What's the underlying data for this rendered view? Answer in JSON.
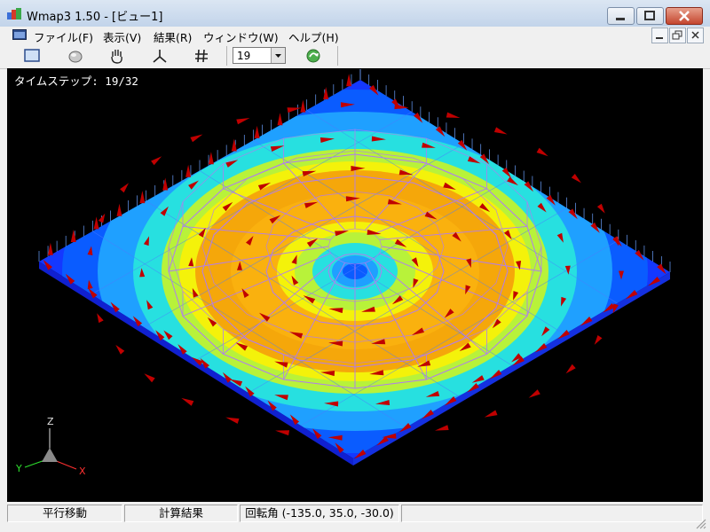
{
  "window": {
    "title": "Wmap3 1.50 - [ビュー1]"
  },
  "menu": {
    "items": [
      {
        "label": "ファイル(F)"
      },
      {
        "label": "表示(V)"
      },
      {
        "label": "結果(R)"
      },
      {
        "label": "ウィンドウ(W)"
      },
      {
        "label": "ヘルプ(H)"
      }
    ]
  },
  "toolbar": {
    "icons": [
      "fit-view-icon",
      "rotate-view-icon",
      "pan-hand-icon",
      "axes-icon",
      "grid-hash-icon",
      "step-forward-icon"
    ],
    "timestep_select": {
      "value": "19"
    }
  },
  "viewport": {
    "timestep_label": "タイムステップ: 19/32",
    "axes": {
      "z": "Z",
      "y": "Y",
      "x": "X"
    },
    "colors": {
      "background": "#000000",
      "mesh": "#b07cf0",
      "arrow": "#c00000"
    }
  },
  "statusbar": {
    "mode": "平行移動",
    "panel": "計算結果",
    "rotation": "回転角 (-135.0, 35.0, -30.0)"
  }
}
